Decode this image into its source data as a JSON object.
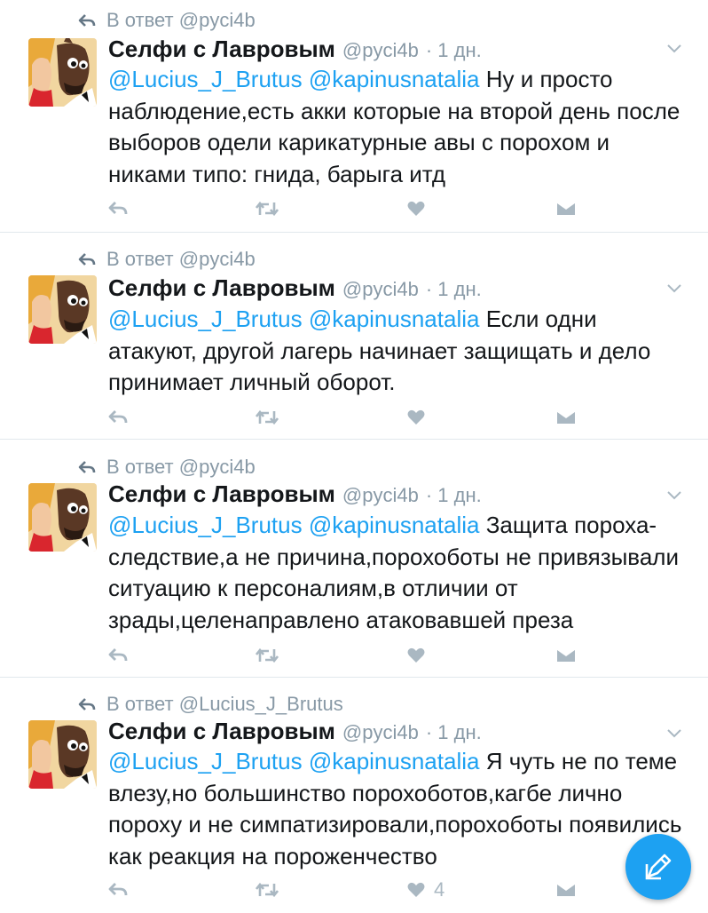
{
  "tweets": [
    {
      "reply_to": "В ответ @pyci4b",
      "name": "Селфи с Лавровым",
      "handle": "@pyci4b",
      "time": "· 1 дн.",
      "mentions": "@Lucius_J_Brutus @kapinusnatalia",
      "text": " Ну и просто наблюдение,есть акки которые на второй день после выборов одели карикатурные авы с порохом и никами типо: гнида, барыга итд",
      "likes": ""
    },
    {
      "reply_to": "В ответ @pyci4b",
      "name": "Селфи с Лавровым",
      "handle": "@pyci4b",
      "time": "· 1 дн.",
      "mentions": "@Lucius_J_Brutus @kapinusnatalia",
      "text": " Если одни атакуют, другой лагерь начинает защищать и дело принимает личный оборот.",
      "likes": ""
    },
    {
      "reply_to": "В ответ @pyci4b",
      "name": "Селфи с Лавровым",
      "handle": "@pyci4b",
      "time": "· 1 дн.",
      "mentions": "@Lucius_J_Brutus @kapinusnatalia",
      "text": " Защита пороха-следствие,а не причина,порохоботы не привязывали ситуацию к персоналиям,в отличии от зрады,целенаправлено атаковавшей преза",
      "likes": ""
    },
    {
      "reply_to": "В ответ @Lucius_J_Brutus",
      "name": "Селфи с Лавровым",
      "handle": "@pyci4b",
      "time": "· 1 дн.",
      "mentions": "@Lucius_J_Brutus @kapinusnatalia",
      "text": " Я чуть не по теме влезу,но большинство порохоботов,кагбе лично пороху и не симпатизировали,порохоботы появились как реакция на пороженчество",
      "likes": "4"
    }
  ],
  "icons": {
    "reply": "reply-icon",
    "retweet": "retweet-icon",
    "like": "heart-icon",
    "dm": "direct-message-icon",
    "menu": "chevron-down-icon",
    "compose": "compose-tweet-icon"
  },
  "colors": {
    "link": "#1da1f2",
    "muted": "#8899a6",
    "icon": "#aab8c2",
    "fab": "#1da1f2"
  }
}
